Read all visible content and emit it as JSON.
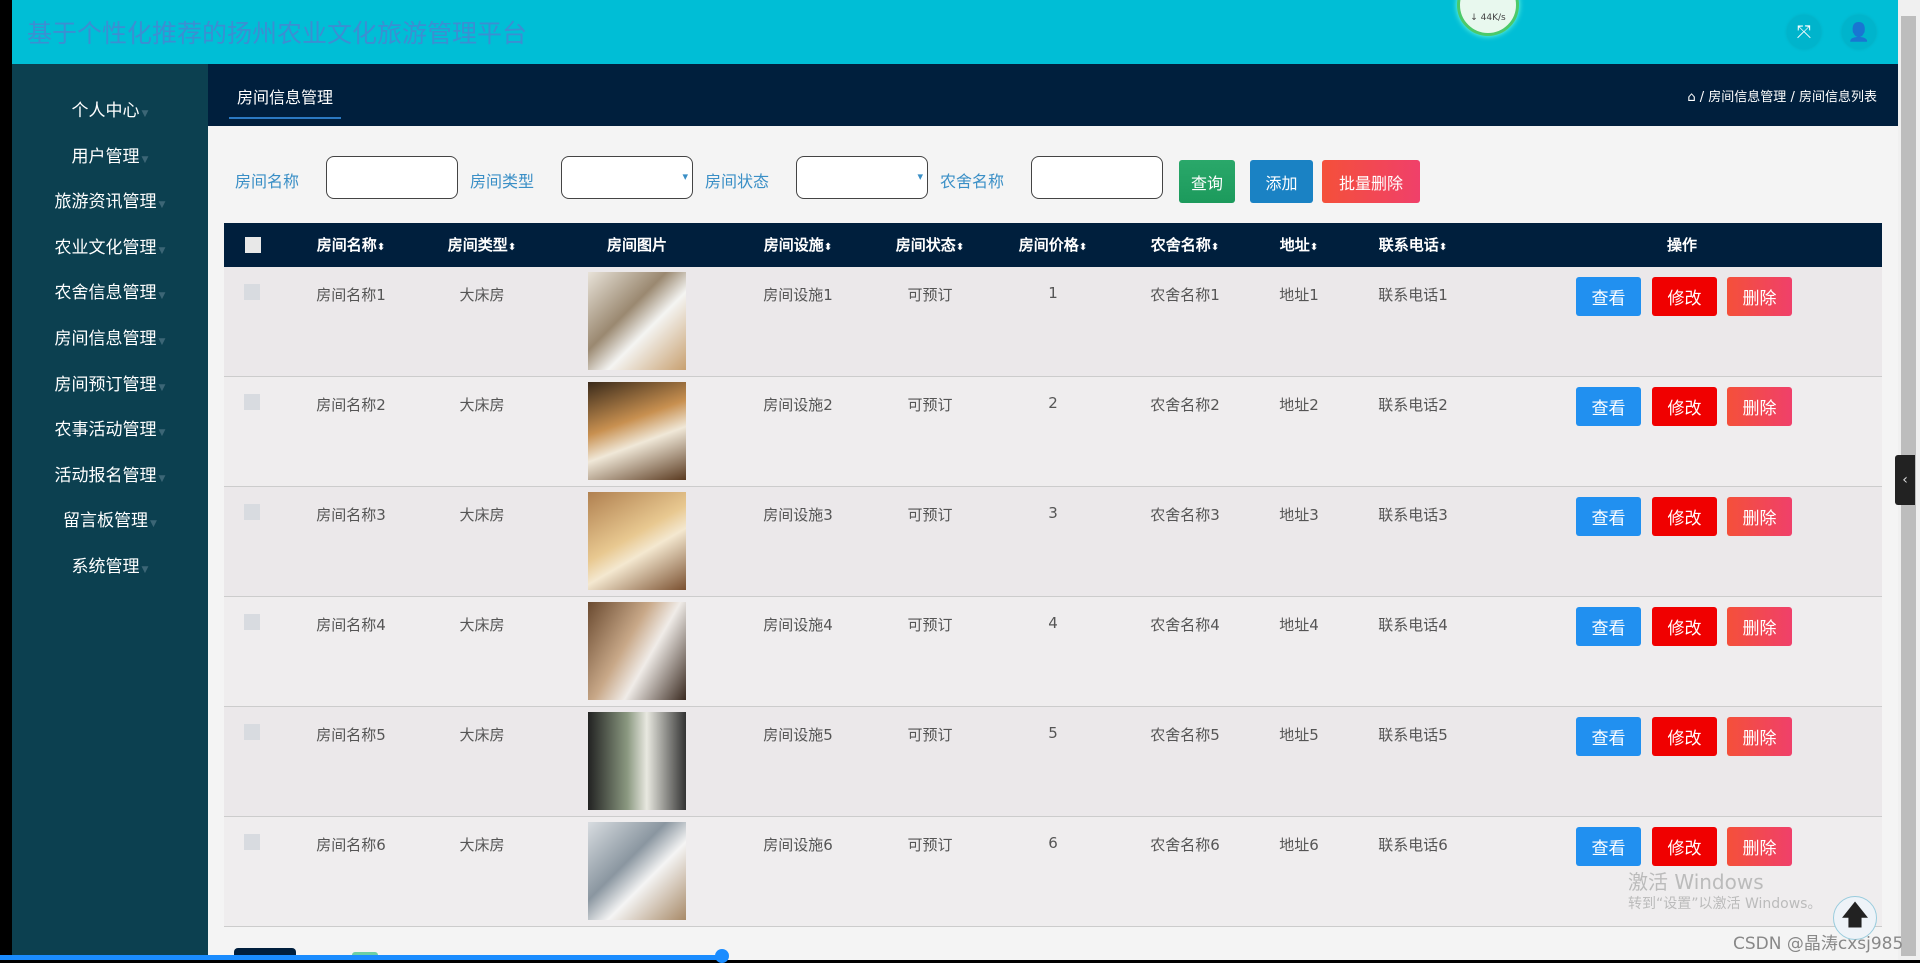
{
  "header": {
    "title": "基于个性化推荐的扬州农业文化旅游管理平台",
    "net_speed": "↓ 44K/s"
  },
  "sidebar": {
    "items": [
      {
        "label": "个人中心"
      },
      {
        "label": "用户管理"
      },
      {
        "label": "旅游资讯管理"
      },
      {
        "label": "农业文化管理"
      },
      {
        "label": "农舍信息管理"
      },
      {
        "label": "房间信息管理"
      },
      {
        "label": "房间预订管理"
      },
      {
        "label": "农事活动管理"
      },
      {
        "label": "活动报名管理"
      },
      {
        "label": "留言板管理"
      },
      {
        "label": "系统管理"
      }
    ]
  },
  "topbar": {
    "tab": "房间信息管理",
    "breadcrumb": [
      "房间信息管理",
      "房间信息列表"
    ],
    "sep": "/"
  },
  "filters": {
    "room_name_label": "房间名称",
    "room_name_value": "",
    "room_type_label": "房间类型",
    "room_type_value": "",
    "room_status_label": "房间状态",
    "room_status_value": "",
    "farmhouse_label": "农舍名称",
    "farmhouse_value": "",
    "search": "查询",
    "add": "添加",
    "batch_delete": "批量删除"
  },
  "table": {
    "headers": [
      "房间名称",
      "房间类型",
      "房间图片",
      "房间设施",
      "房间状态",
      "房间价格",
      "农舍名称",
      "地址",
      "联系电话",
      "操作"
    ],
    "sortable": [
      true,
      true,
      false,
      true,
      true,
      true,
      true,
      true,
      true,
      false
    ],
    "actions": {
      "view": "查看",
      "edit": "修改",
      "delete": "删除"
    },
    "rows": [
      {
        "name": "房间名称1",
        "type": "大床房",
        "facility": "房间设施1",
        "status": "可预订",
        "price": "1",
        "farmhouse": "农舍名称1",
        "address": "地址1",
        "phone": "联系电话1"
      },
      {
        "name": "房间名称2",
        "type": "大床房",
        "facility": "房间设施2",
        "status": "可预订",
        "price": "2",
        "farmhouse": "农舍名称2",
        "address": "地址2",
        "phone": "联系电话2"
      },
      {
        "name": "房间名称3",
        "type": "大床房",
        "facility": "房间设施3",
        "status": "可预订",
        "price": "3",
        "farmhouse": "农舍名称3",
        "address": "地址3",
        "phone": "联系电话3"
      },
      {
        "name": "房间名称4",
        "type": "大床房",
        "facility": "房间设施4",
        "status": "可预订",
        "price": "4",
        "farmhouse": "农舍名称4",
        "address": "地址4",
        "phone": "联系电话4"
      },
      {
        "name": "房间名称5",
        "type": "大床房",
        "facility": "房间设施5",
        "status": "可预订",
        "price": "5",
        "farmhouse": "农舍名称5",
        "address": "地址5",
        "phone": "联系电话5"
      },
      {
        "name": "房间名称6",
        "type": "大床房",
        "facility": "房间设施6",
        "status": "可预订",
        "price": "6",
        "farmhouse": "农舍名称6",
        "address": "地址6",
        "phone": "联系电话6"
      }
    ]
  },
  "watermark": {
    "activate_title": "激活 Windows",
    "activate_sub": "转到“设置”以激活 Windows。",
    "csdn": "CSDN @晶涛cxsj985"
  },
  "colors": {
    "header": "#00bed6",
    "sidebar": "#0c4050",
    "topbar": "#001f3d",
    "view": "#2190f0",
    "edit": "#f00000",
    "delete": "#f0486a"
  }
}
